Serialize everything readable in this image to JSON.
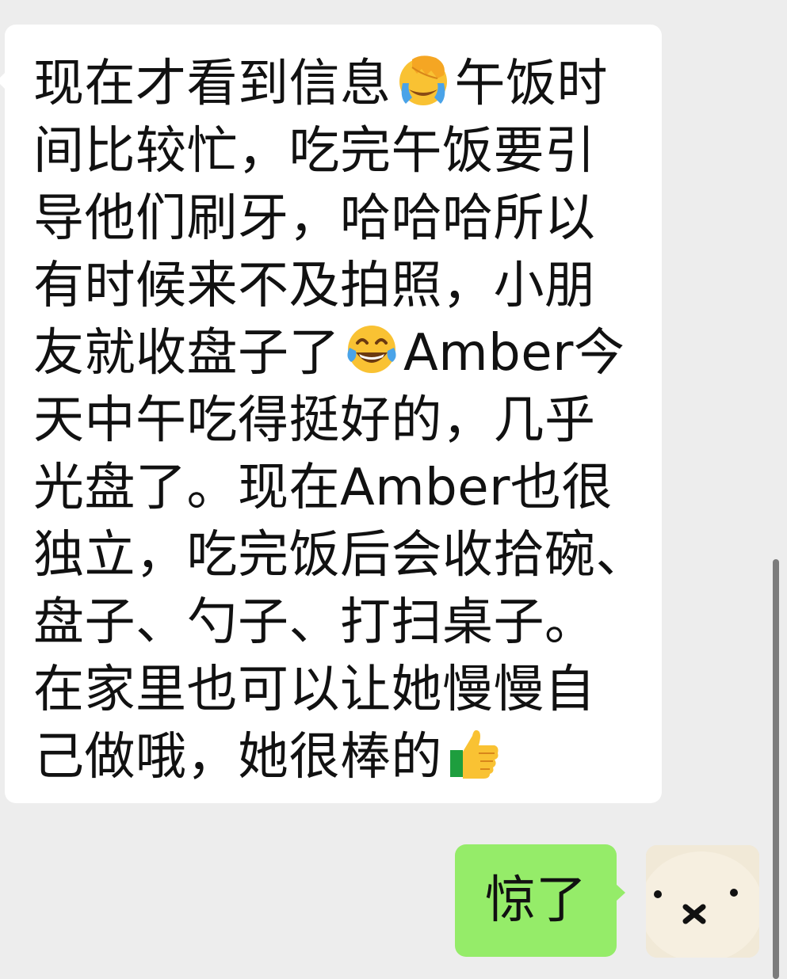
{
  "conversation": {
    "incoming": {
      "lines": [
        {
          "t1": "现在才看到信息",
          "t2": "午饭时"
        },
        {
          "t1": "间比较忙，吃完午饭要引"
        },
        {
          "t1": "导他们刷牙，哈哈哈所以"
        },
        {
          "t1": "有时候来不及拍照，小朋"
        },
        {
          "t1": "友就收盘子了",
          "t2": "Amber今"
        },
        {
          "t1": "天中午吃得挺好的，几乎"
        },
        {
          "t1": "光盘了。现在Amber也很"
        },
        {
          "t1": "独立，吃完饭后会收拾碗、"
        },
        {
          "t1": "盘子、勺子、打扫桌子。"
        },
        {
          "t1": "在家里也可以让她慢慢自"
        },
        {
          "t1": "己做哦，她很棒的"
        }
      ],
      "emojis": [
        "face-palm-emoji",
        "tears-of-joy-emoji",
        "thumbs-up-emoji"
      ]
    },
    "outgoing": {
      "text": "惊了"
    }
  },
  "colors": {
    "background": "#ededed",
    "incoming_bubble": "#ffffff",
    "outgoing_bubble": "#95ec69"
  }
}
